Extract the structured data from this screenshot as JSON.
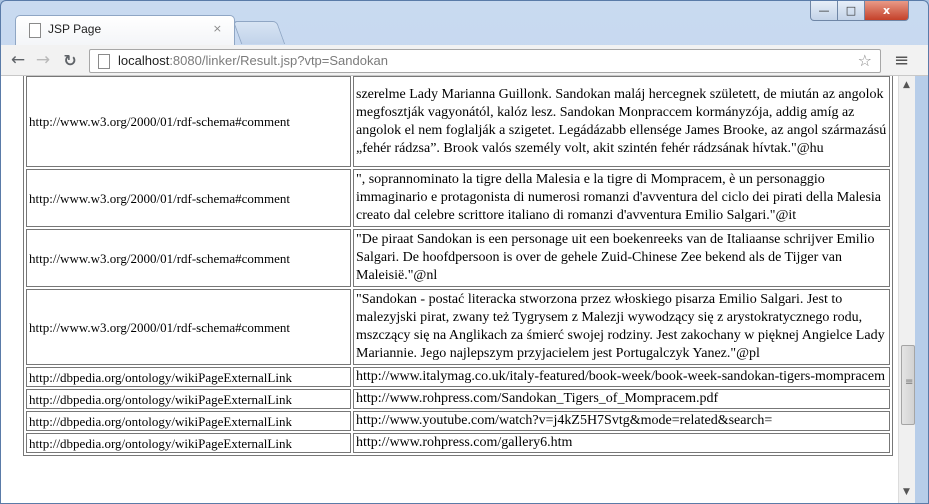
{
  "browser": {
    "tab_title": "JSP Page",
    "tab_close": "×",
    "url_host": "localhost",
    "url_rest": ":8080/linker/Result.jsp?vtp=Sandokan",
    "controls": {
      "minimize": "—",
      "maximize": "□",
      "close": "x"
    }
  },
  "rows": [
    {
      "predicate": "http://www.w3.org/2000/01/rdf-schema#comment",
      "object": "szerelme Lady Marianna Guillonk. Sandokan maláj hercegnek született, de miután az angolok megfosztják vagyonától, kalóz lesz. Sandokan Monpraccem kormányzója, addig amíg az angolok el nem foglalják a szigetet. Legádázabb ellensége James Brooke, az angol származású „fehér rádzsa”. Brook valós személy volt, akit szintén fehér rádzsának hívtak.\"@hu"
    },
    {
      "predicate": "http://www.w3.org/2000/01/rdf-schema#comment",
      "object": "\", soprannominato la tigre della Malesia e la tigre di Mompracem, è un personaggio immaginario e protagonista di numerosi romanzi d'avventura del ciclo dei pirati della Malesia creato dal celebre scrittore italiano di romanzi d'avventura Emilio Salgari.\"@it"
    },
    {
      "predicate": "http://www.w3.org/2000/01/rdf-schema#comment",
      "object": "\"De piraat Sandokan is een personage uit een boekenreeks van de Italiaanse schrijver Emilio Salgari. De hoofdpersoon is over de gehele Zuid-Chinese Zee bekend als de Tijger van Maleisië.\"@nl"
    },
    {
      "predicate": "http://www.w3.org/2000/01/rdf-schema#comment",
      "object": "\"Sandokan - postać literacka stworzona przez włoskiego pisarza Emilio Salgari. Jest to malezyjski pirat, zwany też Tygrysem z Malezji wywodzący się z arystokratycznego rodu, mszczący się na Anglikach za śmierć swojej rodziny. Jest zakochany w pięknej Angielce Lady Mariannie. Jego najlepszym przyjacielem jest Portugalczyk Yanez.\"@pl"
    },
    {
      "predicate": "http://dbpedia.org/ontology/wikiPageExternalLink",
      "object": "http://www.italymag.co.uk/italy-featured/book-week/book-week-sandokan-tigers-mompracem"
    },
    {
      "predicate": "http://dbpedia.org/ontology/wikiPageExternalLink",
      "object": "http://www.rohpress.com/Sandokan_Tigers_of_Mompracem.pdf"
    },
    {
      "predicate": "http://dbpedia.org/ontology/wikiPageExternalLink",
      "object": "http://www.youtube.com/watch?v=j4kZ5H7Svtg&mode=related&search="
    },
    {
      "predicate": "http://dbpedia.org/ontology/wikiPageExternalLink",
      "object": "http://www.rohpress.com/gallery6.htm"
    }
  ]
}
